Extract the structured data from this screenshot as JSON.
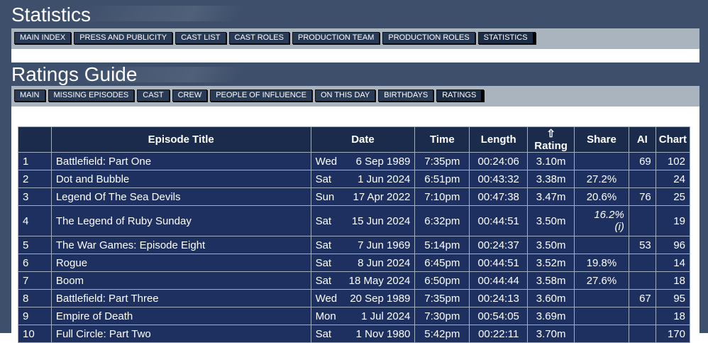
{
  "statistics": {
    "title": "Statistics",
    "nav": [
      "MAIN INDEX",
      "PRESS AND PUBLICITY",
      "CAST LIST",
      "CAST ROLES",
      "PRODUCTION TEAM",
      "PRODUCTION ROLES",
      "STATISTICS"
    ]
  },
  "ratings_guide": {
    "title": "Ratings Guide",
    "nav": [
      "MAIN",
      "MISSING EPISODES",
      "CAST",
      "CREW",
      "PEOPLE OF INFLUENCE",
      "ON THIS DAY",
      "BIRTHDAYS",
      "RATINGS"
    ]
  },
  "table": {
    "headers": {
      "num": "",
      "title": "Episode Title",
      "date": "Date",
      "time": "Time",
      "length": "Length",
      "rating": "⇧ Rating",
      "share": "Share",
      "ai": "AI",
      "chart": "Chart"
    },
    "rows": [
      {
        "num": "1",
        "title": "Battlefield: Part One",
        "day": "Wed",
        "date": "6 Sep 1989",
        "time": "7:35pm",
        "length": "00:24:06",
        "rating": "3.10m",
        "share": "",
        "share_note": "",
        "ai": "69",
        "chart": "102"
      },
      {
        "num": "2",
        "title": "Dot and Bubble",
        "day": "Sat",
        "date": "1 Jun 2024",
        "time": "6:51pm",
        "length": "00:43:32",
        "rating": "3.38m",
        "share": "27.2%",
        "share_note": "",
        "ai": "",
        "chart": "24"
      },
      {
        "num": "3",
        "title": "Legend Of The Sea Devils",
        "day": "Sun",
        "date": "17 Apr 2022",
        "time": "7:10pm",
        "length": "00:47:38",
        "rating": "3.47m",
        "share": "20.6%",
        "share_note": "",
        "ai": "76",
        "chart": "25"
      },
      {
        "num": "4",
        "title": "The Legend of Ruby Sunday",
        "day": "Sat",
        "date": "15 Jun 2024",
        "time": "6:32pm",
        "length": "00:44:51",
        "rating": "3.50m",
        "share": "16.2%",
        "share_note": "(i)",
        "ai": "",
        "chart": "19"
      },
      {
        "num": "5",
        "title": "The War Games: Episode Eight",
        "day": "Sat",
        "date": "7 Jun 1969",
        "time": "5:14pm",
        "length": "00:24:37",
        "rating": "3.50m",
        "share": "",
        "share_note": "",
        "ai": "53",
        "chart": "96"
      },
      {
        "num": "6",
        "title": "Rogue",
        "day": "Sat",
        "date": "8 Jun 2024",
        "time": "6:45pm",
        "length": "00:44:51",
        "rating": "3.52m",
        "share": "19.8%",
        "share_note": "",
        "ai": "",
        "chart": "14"
      },
      {
        "num": "7",
        "title": "Boom",
        "day": "Sat",
        "date": "18 May 2024",
        "time": "6:50pm",
        "length": "00:44:44",
        "rating": "3.58m",
        "share": "27.6%",
        "share_note": "",
        "ai": "",
        "chart": "18"
      },
      {
        "num": "8",
        "title": "Battlefield: Part Three",
        "day": "Wed",
        "date": "20 Sep 1989",
        "time": "7:35pm",
        "length": "00:24:13",
        "rating": "3.60m",
        "share": "",
        "share_note": "",
        "ai": "67",
        "chart": "95"
      },
      {
        "num": "9",
        "title": "Empire of Death",
        "day": "Mon",
        "date": "1 Jul 2024",
        "time": "7:30pm",
        "length": "00:54:05",
        "rating": "3.69m",
        "share": "",
        "share_note": "",
        "ai": "",
        "chart": "18"
      },
      {
        "num": "10",
        "title": "Full Circle: Part Two",
        "day": "Sat",
        "date": "1 Nov 1980",
        "time": "5:42pm",
        "length": "00:22:11",
        "rating": "3.70m",
        "share": "",
        "share_note": "",
        "ai": "",
        "chart": "170"
      }
    ]
  },
  "colors": {
    "header_bg": "#3d4f6b",
    "nav_bar_bg": "#aab4be",
    "nav_btn_bg": "#2a3b57",
    "table_header_bg": "#1a2b4c",
    "table_row_bg": "#1d3060"
  }
}
